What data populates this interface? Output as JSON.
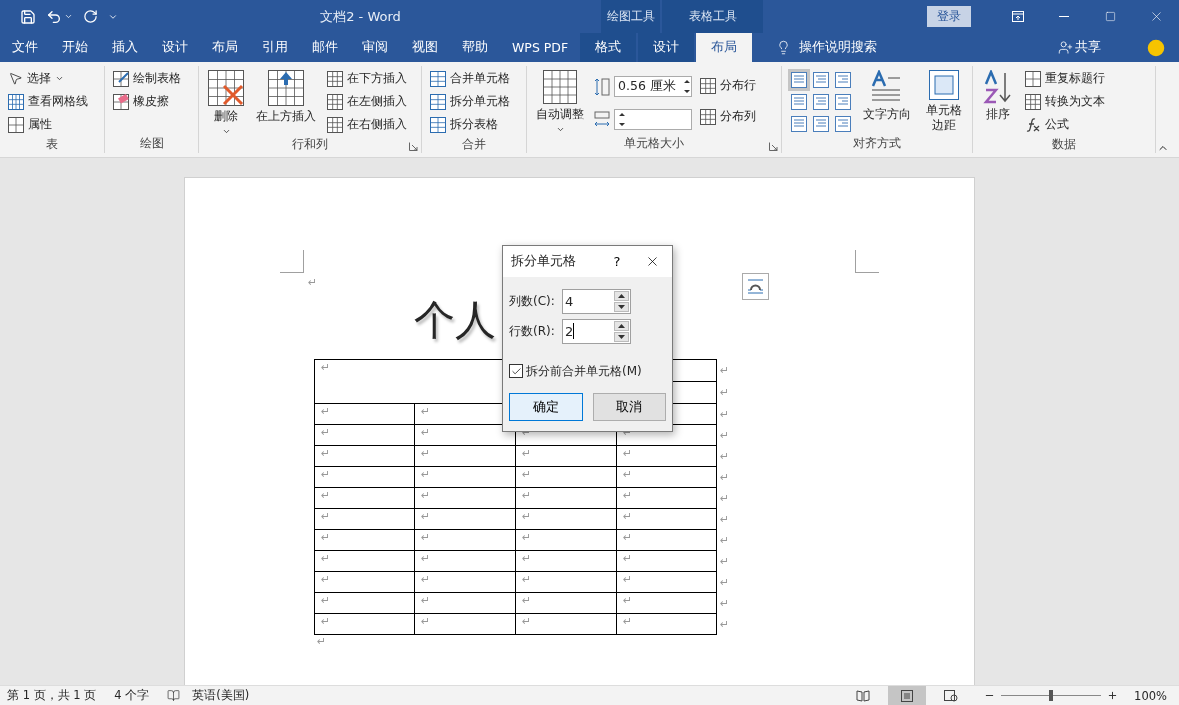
{
  "title_bar": {
    "title": "文档2  -  Word",
    "context_groups": [
      "绘图工具",
      "表格工具"
    ],
    "sign_in": "登录"
  },
  "tabs": [
    {
      "label": "文件",
      "kind": "normal",
      "selected": false
    },
    {
      "label": "开始",
      "kind": "normal",
      "selected": false
    },
    {
      "label": "插入",
      "kind": "normal",
      "selected": false
    },
    {
      "label": "设计",
      "kind": "normal",
      "selected": false
    },
    {
      "label": "布局",
      "kind": "normal",
      "selected": false
    },
    {
      "label": "引用",
      "kind": "normal",
      "selected": false
    },
    {
      "label": "邮件",
      "kind": "normal",
      "selected": false
    },
    {
      "label": "审阅",
      "kind": "normal",
      "selected": false
    },
    {
      "label": "视图",
      "kind": "normal",
      "selected": false
    },
    {
      "label": "帮助",
      "kind": "normal",
      "selected": false
    },
    {
      "label": "WPS PDF",
      "kind": "normal",
      "selected": false
    },
    {
      "label": "格式",
      "kind": "context",
      "selected": false
    },
    {
      "label": "设计",
      "kind": "context",
      "selected": false
    },
    {
      "label": "布局",
      "kind": "context",
      "selected": true
    }
  ],
  "tell_me": "操作说明搜索",
  "share": "共享",
  "ribbon": [
    {
      "label": "表",
      "launcher": false,
      "columns": [
        {
          "kind": "stack",
          "buttons": [
            {
              "label": "选择",
              "dropdown": true
            },
            {
              "label": "查看网格线",
              "dropdown": false
            },
            {
              "label": "属性",
              "dropdown": false
            }
          ]
        }
      ]
    },
    {
      "label": "绘图",
      "launcher": false,
      "columns": [
        {
          "kind": "stack",
          "buttons": [
            {
              "label": "绘制表格",
              "dropdown": false
            },
            {
              "label": "橡皮擦",
              "dropdown": false
            }
          ]
        }
      ]
    },
    {
      "label": "行和列",
      "launcher": true,
      "columns": [
        {
          "kind": "large",
          "buttons": [
            {
              "label": "删除",
              "dropdown": true
            }
          ]
        },
        {
          "kind": "large",
          "buttons": [
            {
              "label": "在上方插入",
              "dropdown": false
            }
          ]
        },
        {
          "kind": "stack",
          "buttons": [
            {
              "label": "在下方插入",
              "dropdown": false
            },
            {
              "label": "在左侧插入",
              "dropdown": false
            },
            {
              "label": "在右侧插入",
              "dropdown": false
            }
          ]
        }
      ]
    },
    {
      "label": "合并",
      "launcher": false,
      "columns": [
        {
          "kind": "stack",
          "buttons": [
            {
              "label": "合并单元格",
              "dropdown": false
            },
            {
              "label": "拆分单元格",
              "dropdown": false
            },
            {
              "label": "拆分表格",
              "dropdown": false
            }
          ]
        }
      ]
    },
    {
      "label": "单元格大小",
      "launcher": true,
      "columns": [
        {
          "kind": "large",
          "buttons": [
            {
              "label": "自动调整",
              "dropdown": true
            }
          ]
        },
        {
          "kind": "spin",
          "fields": [
            {
              "kind": "height",
              "value": "0.56 厘米"
            },
            {
              "kind": "width"
            }
          ]
        },
        {
          "kind": "stack",
          "buttons": [
            {
              "label": "分布行",
              "dropdown": false
            },
            {
              "label": "分布列",
              "dropdown": false
            }
          ]
        }
      ]
    },
    {
      "label": "对齐方式",
      "launcher": false,
      "columns": [
        {
          "kind": "align",
          "cells": [
            {
              "selected": true
            },
            {
              "selected": false
            },
            {
              "selected": false
            },
            {
              "selected": false
            },
            {
              "selected": false
            },
            {
              "selected": false
            },
            {
              "selected": false
            },
            {
              "selected": false
            },
            {
              "selected": false
            }
          ]
        },
        {
          "kind": "large",
          "buttons": [
            {
              "label": "文字方向",
              "dropdown": false
            }
          ]
        },
        {
          "kind": "large",
          "buttons": [
            {
              "label": "单元格边距",
              "dropdown": false
            }
          ]
        }
      ]
    },
    {
      "label": "数据",
      "launcher": false,
      "columns": [
        {
          "kind": "large",
          "buttons": [
            {
              "label": "排序",
              "dropdown": false
            }
          ]
        },
        {
          "kind": "stack",
          "buttons": [
            {
              "label": "重复标题行",
              "dropdown": false
            },
            {
              "label": "转换为文本",
              "dropdown": false
            },
            {
              "label": "公式",
              "dropdown": false
            }
          ]
        }
      ]
    }
  ],
  "document": {
    "paragraph_mark": "↵",
    "title": "个人",
    "after_table_mark": "↵",
    "table": {
      "merged_cell": "↵",
      "right_cells": [
        null,
        null
      ],
      "row_ends": [
        "↵",
        "↵"
      ],
      "rows": [
        {
          "cells": [
            "↵",
            "↵",
            null,
            null
          ],
          "end": "↵"
        },
        {
          "cells": [
            "↵",
            "↵",
            "↵",
            "↵"
          ],
          "end": "↵"
        },
        {
          "cells": [
            "↵",
            "↵",
            "↵",
            "↵"
          ],
          "end": "↵"
        },
        {
          "cells": [
            "↵",
            "↵",
            "↵",
            "↵"
          ],
          "end": "↵"
        },
        {
          "cells": [
            "↵",
            "↵",
            "↵",
            "↵"
          ],
          "end": "↵"
        },
        {
          "cells": [
            "↵",
            "↵",
            "↵",
            "↵"
          ],
          "end": "↵"
        },
        {
          "cells": [
            "↵",
            "↵",
            "↵",
            "↵"
          ],
          "end": "↵"
        },
        {
          "cells": [
            "↵",
            "↵",
            "↵",
            "↵"
          ],
          "end": "↵"
        },
        {
          "cells": [
            "↵",
            "↵",
            "↵",
            "↵"
          ],
          "end": "↵"
        },
        {
          "cells": [
            "↵",
            "↵",
            "↵",
            "↵"
          ],
          "end": "↵"
        },
        {
          "cells": [
            "↵",
            "↵",
            "↵",
            "↵"
          ],
          "end": "↵"
        }
      ]
    }
  },
  "dialog": {
    "title": "拆分单元格",
    "help": "?",
    "fields": [
      {
        "label": "列数(C):",
        "value": "4",
        "focused": false
      },
      {
        "label": "行数(R):",
        "value": "2",
        "focused": true
      }
    ],
    "checkbox": {
      "label": "拆分前合并单元格(M)",
      "checked": true
    },
    "buttons": [
      {
        "label": "确定",
        "default": true
      },
      {
        "label": "取消",
        "default": false
      }
    ]
  },
  "status_bar": {
    "page": "第 1 页，共 1 页",
    "words": "4 个字",
    "language": "英语(美国)",
    "views": [
      {
        "kind": "read",
        "selected": false
      },
      {
        "kind": "print",
        "selected": true
      },
      {
        "kind": "web",
        "selected": false
      }
    ],
    "zoom": {
      "level": 0.5,
      "reading": "100%"
    }
  }
}
